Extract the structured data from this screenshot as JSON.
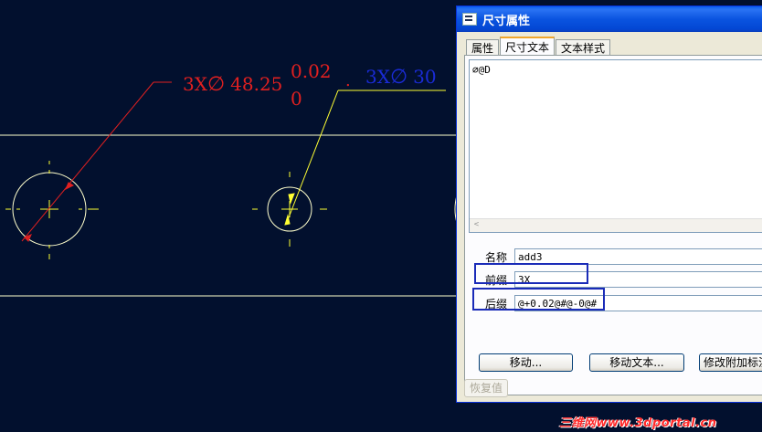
{
  "drawing": {
    "dim_left": {
      "prefix": "3X",
      "symbol": "∅",
      "value": "48.25",
      "upper_tol": "0.02",
      "lower_tol": "0"
    },
    "dim_right": {
      "prefix": "3X",
      "symbol": "∅",
      "value": "30"
    },
    "dim_right_leading_dot": ".",
    "colors": {
      "background": "#02102e",
      "red_dim": "#e02020",
      "blue_dim": "#1a2bd6",
      "yellow_leader": "#ffff33",
      "geometry": "#ffffcc"
    }
  },
  "dialog": {
    "title": "尺寸属性",
    "tabs": [
      "属性",
      "尺寸文本",
      "文本样式"
    ],
    "active_tab": "尺寸文本",
    "dimension_text": "∅@D",
    "fields": {
      "name_label": "名称",
      "name_value": "add3",
      "prefix_label": "前缀",
      "prefix_value": "3X",
      "suffix_label": "后缀",
      "suffix_value": "@+0.02@#@-0@#"
    },
    "buttons": {
      "move": "移动...",
      "move_text": "移动文本...",
      "modify_attached": "修改附加标注",
      "restore": "恢复值"
    }
  },
  "watermark": "三维网www.3dportal.cn"
}
